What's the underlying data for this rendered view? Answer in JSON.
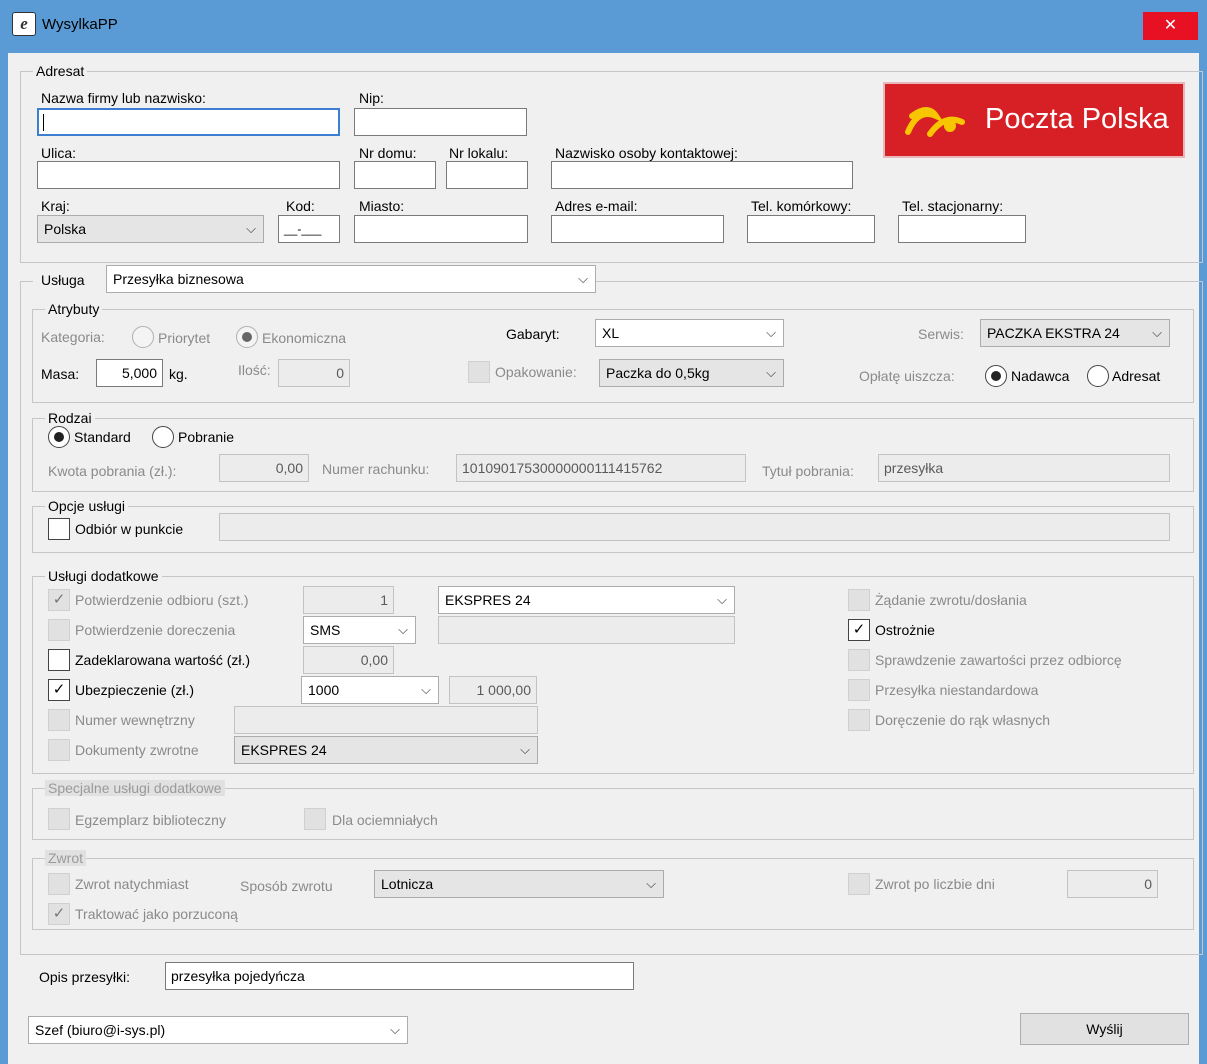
{
  "window": {
    "title": "WysylkaPP",
    "close_glyph": "✕",
    "app_icon": "app-icon"
  },
  "logo": {
    "text": "Poczta Polska"
  },
  "adresat": {
    "legend": "Adresat",
    "nazwa_label": "Nazwa firmy lub nazwisko:",
    "nazwa_value": "",
    "nip_label": "Nip:",
    "nip_value": "",
    "ulica_label": "Ulica:",
    "ulica_value": "",
    "nr_domu_label": "Nr domu:",
    "nr_lokalu_label": "Nr lokalu:",
    "kontakt_label": "Nazwisko osoby kontaktowej:",
    "kraj_label": "Kraj:",
    "kraj_value": "Polska",
    "kod_label": "Kod:",
    "kod_value": "__-___",
    "miasto_label": "Miasto:",
    "email_label": "Adres e-mail:",
    "tel_kom_label": "Tel. komórkowy:",
    "tel_stac_label": "Tel. stacjonarny:"
  },
  "usluga": {
    "legend": "Usługa",
    "value": "Przesyłka biznesowa",
    "atrybuty": {
      "legend": "Atrybuty",
      "kategoria_label": "Kategoria:",
      "priorytet_label": "Priorytet",
      "ekonomiczna_label": "Ekonomiczna",
      "gabaryt_label": "Gabaryt:",
      "gabaryt_value": "XL",
      "serwis_label": "Serwis:",
      "serwis_value": "PACZKA EKSTRA 24",
      "masa_label": "Masa:",
      "masa_value": "5,000",
      "masa_unit": "kg.",
      "ilosc_label": "Ilość:",
      "ilosc_value": "0",
      "opakowanie_label": "Opakowanie:",
      "opakowanie_value": "Paczka do 0,5kg",
      "oplate_label": "Opłatę uiszcza:",
      "nadawca_label": "Nadawca",
      "adresat_label": "Adresat"
    },
    "rodzai": {
      "legend": "Rodzai",
      "standard_label": "Standard",
      "pobranie_label": "Pobranie",
      "kwota_label": "Kwota pobrania (zł.):",
      "kwota_value": "0,00",
      "rachunek_label": "Numer rachunku:",
      "rachunek_value": "10109017530000000111415762",
      "tytul_label": "Tytuł pobrania:",
      "tytul_value": "przesyłka"
    },
    "opcje": {
      "legend": "Opcje usługi",
      "odbior_label": "Odbiór w punkcie"
    },
    "dodatkowe": {
      "legend": "Usługi dodatkowe",
      "potw_odbioru_label": "Potwierdzenie odbioru (szt.)",
      "potw_odbioru_value": "1",
      "potw_odbioru_select": "EKSPRES 24",
      "potw_dor_label": "Potwierdzenie doreczenia",
      "potw_dor_select": "SMS",
      "zadekl_label": "Zadeklarowana wartość (zł.)",
      "zadekl_value": "0,00",
      "ubezp_label": "Ubezpieczenie (zł.)",
      "ubezp_select": "1000",
      "ubezp_value": "1 000,00",
      "numer_wewn_label": "Numer wewnętrzny",
      "dok_zwrotne_label": "Dokumenty zwrotne",
      "dok_zwrotne_select": "EKSPRES 24",
      "zadanie_label": "Żądanie zwrotu/dosłania",
      "ostroznie_label": "Ostrożnie",
      "sprawdzenie_label": "Sprawdzenie zawartości przez odbiorcę",
      "niestand_label": "Przesyłka niestandardowa",
      "rak_label": "Doręczenie do rąk własnych"
    },
    "specjalne": {
      "legend": "Specjalne usługi dodatkowe",
      "egzemplarz_label": "Egzemplarz biblioteczny",
      "ociemn_label": "Dla ociemniałych"
    },
    "zwrot": {
      "legend": "Zwrot",
      "natychmiast_label": "Zwrot natychmiast",
      "sposob_label": "Sposób zwrotu",
      "sposob_value": "Lotnicza",
      "po_dniach_label": "Zwrot po liczbie dni",
      "dni_value": "0",
      "porzucona_label": "Traktować jako porzuconą"
    }
  },
  "opis": {
    "label": "Opis przesyłki:",
    "value": "przesyłka pojedyńcza"
  },
  "konto": {
    "value": "Szef  (biuro@i-sys.pl)"
  },
  "send_button": "Wyślij",
  "glyphs": {
    "check": "✓",
    "arrow": "⌵"
  }
}
